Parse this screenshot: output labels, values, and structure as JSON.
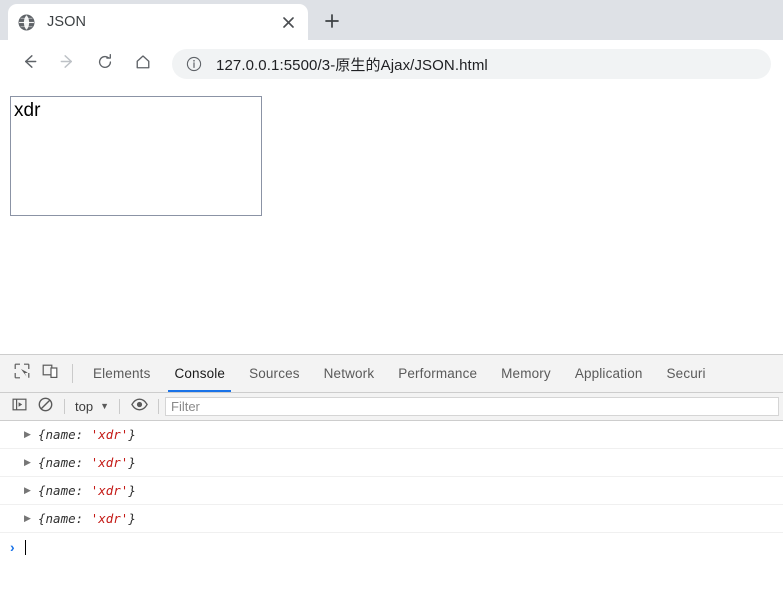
{
  "browser": {
    "tab": {
      "title": "JSON",
      "favicon_icon": "globe-icon",
      "close_icon": "close-icon"
    },
    "new_tab_icon": "plus-icon",
    "nav": {
      "back_icon": "arrow-left-icon",
      "forward_icon": "arrow-right-icon",
      "reload_icon": "reload-icon",
      "home_icon": "home-icon"
    },
    "omnibox": {
      "info_icon": "info-circle-icon",
      "url": "127.0.0.1:5500/3-原生的Ajax/JSON.html"
    }
  },
  "page": {
    "box_text": "xdr"
  },
  "devtools": {
    "toolbar_icons": {
      "inspect": "inspect-element-icon",
      "device": "device-toolbar-icon"
    },
    "tabs": [
      {
        "label": "Elements",
        "active": false
      },
      {
        "label": "Console",
        "active": true
      },
      {
        "label": "Sources",
        "active": false
      },
      {
        "label": "Network",
        "active": false
      },
      {
        "label": "Performance",
        "active": false
      },
      {
        "label": "Memory",
        "active": false
      },
      {
        "label": "Application",
        "active": false
      },
      {
        "label": "Securi",
        "active": false
      }
    ],
    "console_toolbar": {
      "sidebar_icon": "console-sidebar-icon",
      "clear_icon": "clear-console-icon",
      "context": "top",
      "context_caret": "▼",
      "eye_icon": "live-expression-eye-icon",
      "filter_placeholder": "Filter",
      "filter_value": ""
    },
    "console_messages": [
      {
        "arrow": "▶",
        "prefix": "{name: ",
        "value": "'xdr'",
        "suffix": "}"
      },
      {
        "arrow": "▶",
        "prefix": "{name: ",
        "value": "'xdr'",
        "suffix": "}"
      },
      {
        "arrow": "▶",
        "prefix": "{name: ",
        "value": "'xdr'",
        "suffix": "}"
      },
      {
        "arrow": "▶",
        "prefix": "{name: ",
        "value": "'xdr'",
        "suffix": "}"
      }
    ],
    "prompt": {
      "caret": "›",
      "input_value": ""
    },
    "colors": {
      "accent": "#1a73e8",
      "string_token": "#c41a16",
      "chrome_bg": "#dee1e6",
      "devtools_bg": "#f3f3f3"
    }
  }
}
